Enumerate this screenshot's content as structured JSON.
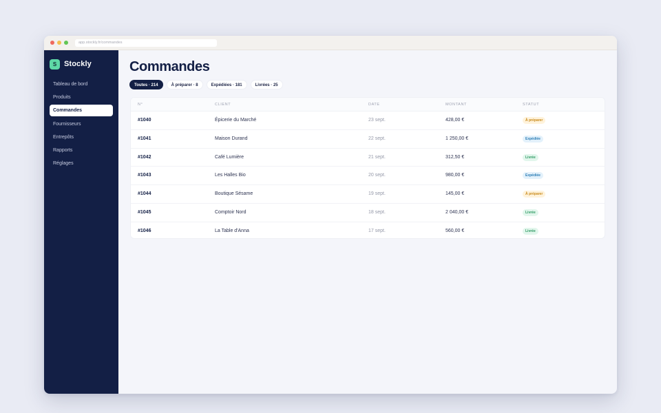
{
  "browser": {
    "url": "app.stockly.fr/commandes"
  },
  "sidebar": {
    "brand_initial": "S",
    "brand_name": "Stockly",
    "items": [
      {
        "label": "Tableau de bord",
        "active": false
      },
      {
        "label": "Produits",
        "active": false
      },
      {
        "label": "Commandes",
        "active": true
      },
      {
        "label": "Fournisseurs",
        "active": false
      },
      {
        "label": "Entrepôts",
        "active": false
      },
      {
        "label": "Rapports",
        "active": false
      },
      {
        "label": "Réglages",
        "active": false
      }
    ]
  },
  "main": {
    "title": "Commandes",
    "filters": [
      {
        "label": "Toutes · 214",
        "active": true
      },
      {
        "label": "À préparer · 8",
        "active": false
      },
      {
        "label": "Expédiées · 181",
        "active": false
      },
      {
        "label": "Livrées · 25",
        "active": false
      }
    ],
    "table": {
      "headers": [
        "N°",
        "CLIENT",
        "DATE",
        "MONTANT",
        "STATUT"
      ],
      "rows": [
        {
          "id": "#1040",
          "client": "Épicerie du Marché",
          "date": "23 sept.",
          "amount": "428,00 €",
          "status": "À préparer",
          "status_key": "prep"
        },
        {
          "id": "#1041",
          "client": "Maison Durand",
          "date": "22 sept.",
          "amount": "1 250,00 €",
          "status": "Expédiée",
          "status_key": "ship"
        },
        {
          "id": "#1042",
          "client": "Café Lumière",
          "date": "21 sept.",
          "amount": "312,50 €",
          "status": "Livrée",
          "status_key": "done"
        },
        {
          "id": "#1043",
          "client": "Les Halles Bio",
          "date": "20 sept.",
          "amount": "980,00 €",
          "status": "Expédiée",
          "status_key": "ship"
        },
        {
          "id": "#1044",
          "client": "Boutique Sésame",
          "date": "19 sept.",
          "amount": "145,00 €",
          "status": "À préparer",
          "status_key": "prep"
        },
        {
          "id": "#1045",
          "client": "Comptoir Nord",
          "date": "18 sept.",
          "amount": "2 040,00 €",
          "status": "Livrée",
          "status_key": "done"
        },
        {
          "id": "#1046",
          "client": "La Table d'Anna",
          "date": "17 sept.",
          "amount": "560,00 €",
          "status": "Livrée",
          "status_key": "done"
        }
      ]
    }
  },
  "colors": {
    "sidebar_bg": "#131f45",
    "brand_accent": "#5ed8a6",
    "status": {
      "prep": {
        "bg": "#fff3dc",
        "fg": "#c98a1b"
      },
      "ship": {
        "bg": "#e3f1fb",
        "fg": "#2e7fb6"
      },
      "done": {
        "bg": "#e2f6ec",
        "fg": "#2f9a63"
      }
    }
  }
}
